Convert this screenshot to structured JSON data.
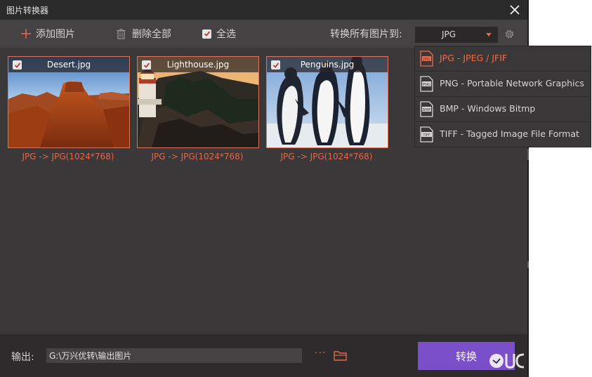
{
  "window": {
    "title": "图片转换器"
  },
  "toolbar": {
    "add_label": "添加图片",
    "delete_all_label": "删除全部",
    "select_all_label": "全选",
    "convert_all_label": "转换所有图片到:",
    "format_value": "JPG"
  },
  "images": [
    {
      "name": "Desert.jpg",
      "caption": "JPG -> JPG(1024*768)",
      "checked": true
    },
    {
      "name": "Lighthouse.jpg",
      "caption": "JPG -> JPG(1024*768)",
      "checked": true
    },
    {
      "name": "Penguins.jpg",
      "caption": "JPG -> JPG(1024*768)",
      "checked": true
    }
  ],
  "format_options": [
    {
      "icon": "jpg-file-icon",
      "icon_text": "JPG",
      "label": "JPG - JPEG / JFIF",
      "selected": true
    },
    {
      "icon": "png-file-icon",
      "icon_text": "PNG",
      "label": "PNG - Portable Network Graphics",
      "selected": false
    },
    {
      "icon": "bmp-file-icon",
      "icon_text": "BMP",
      "label": "BMP - Windows Bitmp",
      "selected": false
    },
    {
      "icon": "tiff-file-icon",
      "icon_text": "TIFF",
      "label": "TIFF - Tagged Image File Format",
      "selected": false
    }
  ],
  "footer": {
    "output_label": "输出:",
    "output_path": "G:\\万兴优转\\输出图片",
    "more_label": "···",
    "convert_label": "转换"
  },
  "colors": {
    "accent": "#e8664a",
    "button": "#7b4fc9",
    "window_bg": "#3b3839",
    "toolbar_bg": "#454243"
  }
}
